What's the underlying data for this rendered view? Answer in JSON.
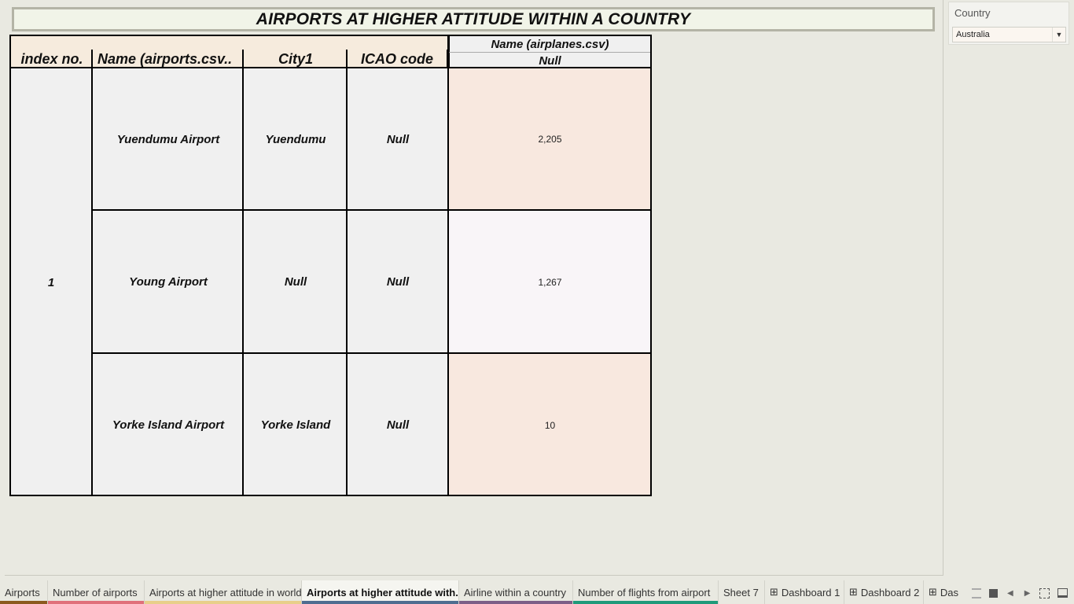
{
  "title": "AIRPORTS AT HIGHER ATTITUDE WITHIN A COUNTRY",
  "table": {
    "columns": {
      "index": "index no.",
      "name": "Name (airports.csv..",
      "city": "City1",
      "icao": "ICAO code"
    },
    "measure_header": {
      "label": "Name (airplanes.csv)",
      "sub": "Null"
    },
    "group_index": "1",
    "rows": [
      {
        "name": "Yuendumu Airport",
        "city": "Yuendumu",
        "icao": "Null",
        "value": "2,205",
        "color": "#f8e8df"
      },
      {
        "name": "Young Airport",
        "city": "Null",
        "icao": "Null",
        "value": "1,267",
        "color": "#f9f5f8"
      },
      {
        "name": "Yorke Island Airport",
        "city": "Yorke Island",
        "icao": "Null",
        "value": "10",
        "color": "#f8e8df"
      }
    ]
  },
  "filter": {
    "title": "Country",
    "selected": "Australia"
  },
  "tabs": [
    {
      "label": "Airports",
      "stripe": "#8b5a1e",
      "icon": ""
    },
    {
      "label": "Number of airports",
      "stripe": "#e0707a",
      "icon": ""
    },
    {
      "label": "Airports at higher attitude in world",
      "stripe": "#e8cf8a",
      "icon": ""
    },
    {
      "label": "Airports at higher attitude with...",
      "stripe": "#4e6d90",
      "icon": "",
      "active": true
    },
    {
      "label": "Airline within a country",
      "stripe": "#7c5e87",
      "icon": ""
    },
    {
      "label": "Number of flights from airport",
      "stripe": "#1f9a7a",
      "icon": ""
    },
    {
      "label": "Sheet 7",
      "stripe": "",
      "icon": ""
    },
    {
      "label": "Dashboard 1",
      "stripe": "",
      "icon": "⊞"
    },
    {
      "label": "Dashboard 2",
      "stripe": "",
      "icon": "⊞"
    },
    {
      "label": "Das",
      "stripe": "",
      "icon": "⊞"
    }
  ]
}
